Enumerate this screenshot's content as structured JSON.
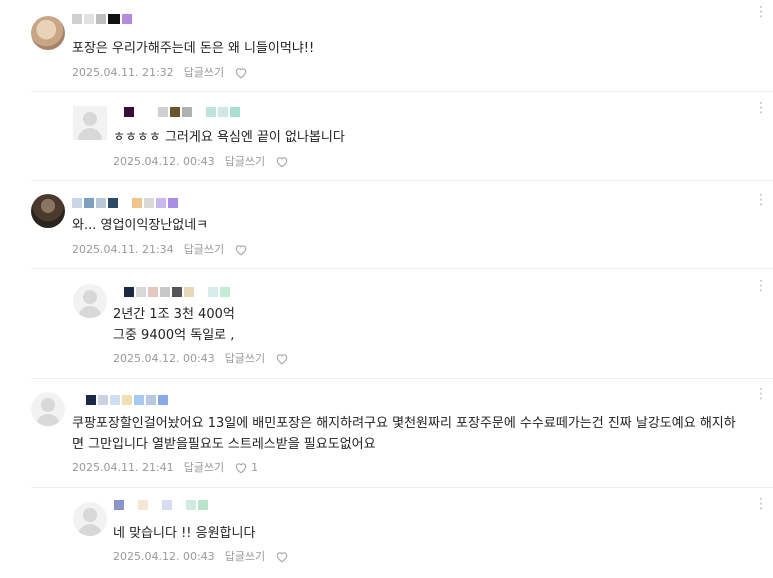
{
  "comments": [
    {
      "text": "포장은 우리가해주는데 돈은 왜 니들이먹냐!!",
      "date": "2025.04.11. 21:32",
      "reply_label": "답글쓰기",
      "like_count": ""
    },
    {
      "text": "ㅎㅎㅎㅎ 그러게요 욕심엔 끝이 없나봅니다",
      "date": "2025.04.12. 00:43",
      "reply_label": "답글쓰기",
      "like_count": ""
    },
    {
      "text": "와... 영업이익장난없네ㅋ",
      "date": "2025.04.11. 21:34",
      "reply_label": "답글쓰기",
      "like_count": ""
    },
    {
      "text": "2년간 1조 3천 400억\n그중 9400억 독일로 ,",
      "date": "2025.04.12. 00:43",
      "reply_label": "답글쓰기",
      "like_count": ""
    },
    {
      "text": "쿠팡포장할인걸어놨어요 13일에 배민포장은 해지하려구요 몇천원짜리 포장주문에 수수료떼가는건 진짜 날강도예요 해지하면 그만입니다 열받을필요도 스트레스받을 필요도없어요",
      "date": "2025.04.11. 21:41",
      "reply_label": "답글쓰기",
      "like_count": "1"
    },
    {
      "text": "네 맞습니다 !! 응원합니다",
      "date": "2025.04.12. 00:43",
      "reply_label": "답글쓰기",
      "like_count": ""
    }
  ],
  "more_icon": "more-vertical-icon",
  "like_icon": "heart-outline-icon"
}
